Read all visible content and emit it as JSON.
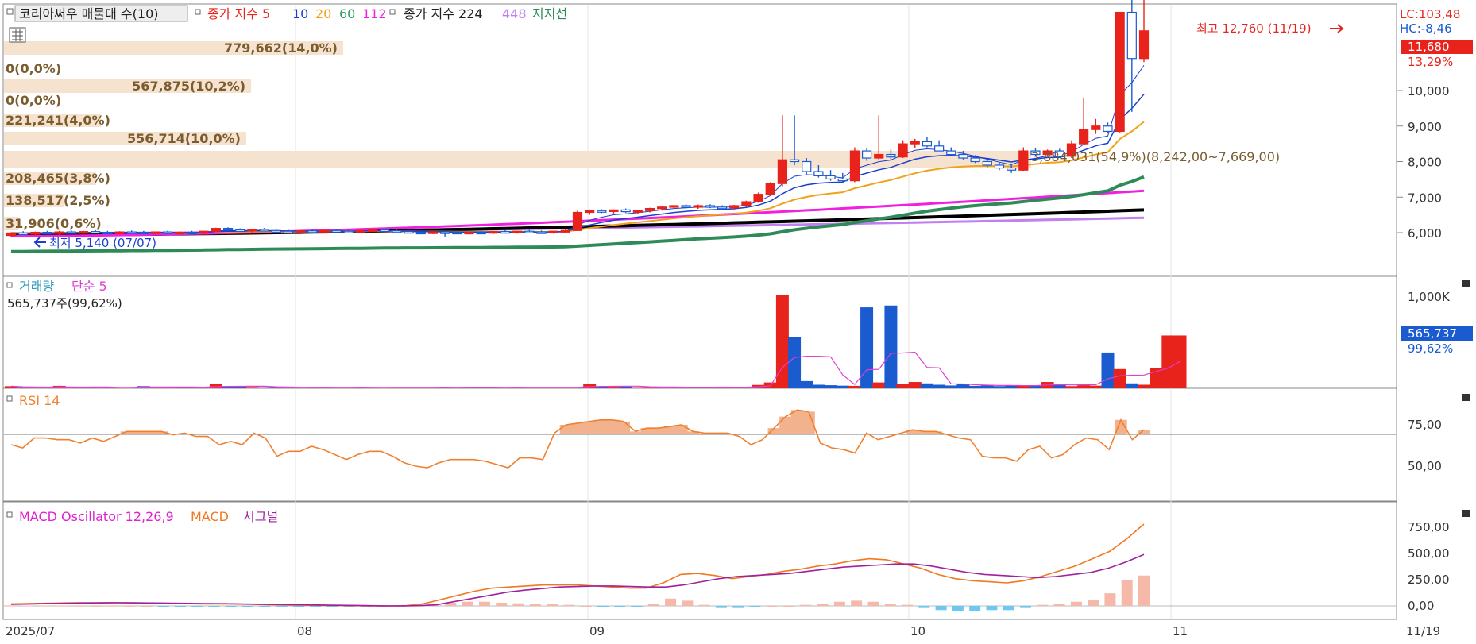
{
  "colors": {
    "up": "#e8231b",
    "down": "#1a5bd0",
    "ma5": "#1a3fd0",
    "ma10": "#1a3fd0",
    "ma20": "#f0a21a",
    "ma60": "#2e9a5e",
    "ma112": "#f020e0",
    "ma224": "#000000",
    "ma448": "#c080f0",
    "support": "#2e8b57",
    "volume_ma": "#e040d0",
    "rsi": "#f08030",
    "rsi_fill": "#f2b28e",
    "macd": "#f07820",
    "signal": "#a020a0",
    "osc_pos": "#f6b8a8",
    "osc_neg": "#6cc8f0",
    "profile": "#f5e3cf"
  },
  "price_panel": {
    "legend": {
      "title": "코리아써우 매물대 수(10)",
      "ma_label": "종가 지수 5",
      "ma_10": "10",
      "ma_20": "20",
      "ma_60": "60",
      "ma_112": "112",
      "ma_long_label": "종가 지수 224",
      "ma_448": "448",
      "support": "지지선"
    },
    "high_label": "최고 12,760 (11/19)",
    "low_label": "최저 5,140 (07/07)",
    "current_label": "3,884,031(54,9%)(8,242,00~7,669,00)",
    "axis_badge_lc": "LC:103,48",
    "axis_badge_hc": "HC:-8,46",
    "current_price": "11,680",
    "current_pct": "13,29%",
    "yaxis_ticks": [
      "10,000",
      "9,000",
      "8,000",
      "7,000",
      "6,000"
    ]
  },
  "volume_profile": [
    {
      "label": "779,662(14,0%)",
      "pct": 14.0
    },
    {
      "label": "0(0,0%)",
      "pct": 0
    },
    {
      "label": "567,875(10,2%)",
      "pct": 10.2
    },
    {
      "label": "0(0,0%)",
      "pct": 0
    },
    {
      "label": "221,241(4,0%)",
      "pct": 4.0
    },
    {
      "label": "556,714(10,0%)",
      "pct": 10.0
    },
    {
      "label": "",
      "pct": 54.9
    },
    {
      "label": "208,465(3,8%)",
      "pct": 3.8
    },
    {
      "label": "138,517(2,5%)",
      "pct": 2.5
    },
    {
      "label": "31,906(0,6%)",
      "pct": 0.6
    }
  ],
  "volume_panel": {
    "legend_vol": "거래량",
    "legend_ma": "단순 5",
    "current_text": "565,737주(99,62%)",
    "axis_tick": "1,000K",
    "current_value": "565,737",
    "current_pct": "99,62%"
  },
  "rsi_panel": {
    "legend": "RSI 14",
    "ticks": [
      "75,00",
      "50,00"
    ]
  },
  "macd_panel": {
    "legend_osc": "MACD Oscillator 12,26,9",
    "legend_macd": "MACD",
    "legend_signal": "시그널",
    "ticks": [
      "750,00",
      "500,00",
      "250,00",
      "0,00"
    ]
  },
  "x_axis": {
    "labels": [
      "2025/07",
      "08",
      "09",
      "10",
      "11",
      "11/19"
    ]
  },
  "chart_data": [
    {
      "type": "candlestick",
      "title": "코리아써우",
      "ylim": [
        5140,
        12760
      ],
      "x_start": "2025-07-01",
      "x_end": "2025-11-19",
      "key_points": [
        {
          "date": "07/07",
          "low": 5140
        },
        {
          "date": "09/08",
          "close": 6600
        },
        {
          "date": "10/02",
          "close": 8050
        },
        {
          "date": "10/14",
          "close": 8000
        },
        {
          "date": "10/23",
          "close": 8300
        },
        {
          "date": "11/13",
          "close": 8400
        },
        {
          "date": "11/17",
          "close": 12200
        },
        {
          "date": "11/19",
          "high": 12760,
          "close": 11680
        }
      ],
      "candles": [
        [
          5920,
          6010,
          5870,
          5990
        ],
        [
          5990,
          6040,
          5950,
          5960
        ],
        [
          5960,
          6030,
          5920,
          6010
        ],
        [
          6010,
          6050,
          5960,
          5980
        ],
        [
          5980,
          6050,
          5940,
          6020
        ],
        [
          6020,
          6060,
          5980,
          6000
        ],
        [
          6000,
          6050,
          5960,
          6030
        ],
        [
          6030,
          6070,
          5990,
          6010
        ],
        [
          6010,
          6050,
          5970,
          6000
        ],
        [
          6000,
          6040,
          5950,
          6020
        ],
        [
          6020,
          6060,
          5980,
          6010
        ],
        [
          6010,
          6050,
          5960,
          5990
        ],
        [
          5990,
          6030,
          5950,
          6020
        ],
        [
          6020,
          6060,
          5980,
          6000
        ],
        [
          6000,
          6040,
          5960,
          6010
        ],
        [
          6010,
          6050,
          5970,
          5990
        ],
        [
          5990,
          6030,
          5940,
          6040
        ],
        [
          6040,
          6140,
          6010,
          6120
        ],
        [
          6120,
          6150,
          6060,
          6080
        ],
        [
          6080,
          6120,
          6030,
          6050
        ],
        [
          6050,
          6110,
          6010,
          6090
        ],
        [
          6090,
          6130,
          6040,
          6060
        ],
        [
          6060,
          6100,
          6010,
          6040
        ],
        [
          6040,
          6080,
          5990,
          6020
        ],
        [
          6020,
          6070,
          5980,
          6050
        ],
        [
          6050,
          6090,
          6000,
          6030
        ],
        [
          6030,
          6070,
          5980,
          6060
        ],
        [
          6060,
          6100,
          6010,
          6040
        ],
        [
          6040,
          6080,
          5990,
          6020
        ],
        [
          6020,
          6070,
          5980,
          6060
        ],
        [
          6060,
          6100,
          6020,
          6080
        ],
        [
          6080,
          6110,
          6030,
          6050
        ],
        [
          6050,
          6090,
          6000,
          6030
        ],
        [
          6030,
          6070,
          5980,
          6010
        ],
        [
          6010,
          6060,
          5970,
          6000
        ],
        [
          6000,
          6040,
          5960,
          6020
        ],
        [
          6020,
          6060,
          5890,
          6010
        ],
        [
          6010,
          6040,
          5960,
          5990
        ],
        [
          5990,
          6030,
          5950,
          6010
        ],
        [
          6010,
          6050,
          5970,
          6000
        ],
        [
          6000,
          6040,
          5960,
          6030
        ],
        [
          6030,
          6070,
          5990,
          6010
        ],
        [
          6010,
          6050,
          5970,
          6040
        ],
        [
          6040,
          6080,
          6000,
          6020
        ],
        [
          6020,
          6060,
          5980,
          6010
        ],
        [
          6010,
          6050,
          5970,
          6040
        ],
        [
          6040,
          6090,
          6000,
          6060
        ],
        [
          6060,
          6620,
          6050,
          6570
        ],
        [
          6570,
          6650,
          6500,
          6620
        ],
        [
          6620,
          6660,
          6550,
          6600
        ],
        [
          6600,
          6650,
          6540,
          6640
        ],
        [
          6640,
          6680,
          6560,
          6590
        ],
        [
          6590,
          6640,
          6530,
          6620
        ],
        [
          6620,
          6700,
          6570,
          6680
        ],
        [
          6680,
          6740,
          6620,
          6720
        ],
        [
          6720,
          6780,
          6660,
          6760
        ],
        [
          6760,
          6800,
          6690,
          6730
        ],
        [
          6730,
          6790,
          6670,
          6760
        ],
        [
          6760,
          6800,
          6690,
          6720
        ],
        [
          6720,
          6770,
          6660,
          6700
        ],
        [
          6700,
          6780,
          6640,
          6760
        ],
        [
          6760,
          6900,
          6720,
          6870
        ],
        [
          6870,
          7130,
          6840,
          7080
        ],
        [
          7080,
          7420,
          7040,
          7380
        ],
        [
          7380,
          9300,
          7300,
          8050
        ],
        [
          8050,
          9300,
          7900,
          8000
        ],
        [
          8000,
          8100,
          7650,
          7720
        ],
        [
          7720,
          7900,
          7550,
          7600
        ],
        [
          7600,
          7760,
          7460,
          7510
        ],
        [
          7510,
          7680,
          7420,
          7460
        ],
        [
          7460,
          8400,
          7420,
          8300
        ],
        [
          8300,
          8380,
          8020,
          8100
        ],
        [
          8100,
          9300,
          8050,
          8200
        ],
        [
          8200,
          8340,
          8060,
          8130
        ],
        [
          8130,
          8600,
          8100,
          8500
        ],
        [
          8500,
          8640,
          8380,
          8560
        ],
        [
          8560,
          8700,
          8400,
          8440
        ],
        [
          8440,
          8600,
          8330,
          8300
        ],
        [
          8300,
          8400,
          8160,
          8200
        ],
        [
          8200,
          8300,
          8060,
          8100
        ],
        [
          8100,
          8180,
          7960,
          8000
        ],
        [
          8000,
          8080,
          7840,
          7900
        ],
        [
          7900,
          7980,
          7760,
          7820
        ],
        [
          7820,
          7900,
          7680,
          7760
        ],
        [
          7760,
          8400,
          7740,
          8300
        ],
        [
          8300,
          8380,
          8150,
          8200
        ],
        [
          8200,
          8340,
          8150,
          8300
        ],
        [
          8300,
          8360,
          8100,
          8150
        ],
        [
          8150,
          8600,
          8100,
          8500
        ],
        [
          8500,
          9800,
          8460,
          8900
        ],
        [
          8900,
          9200,
          8780,
          9000
        ],
        [
          9000,
          9100,
          8800,
          8850
        ],
        [
          8850,
          12200,
          8820,
          12200
        ],
        [
          12200,
          12760,
          9400,
          10900
        ],
        [
          10900,
          12760,
          10800,
          11680
        ]
      ]
    },
    {
      "type": "bar",
      "title": "거래량",
      "series": [
        {
          "name": "단순 5",
          "values": [
            14,
            2,
            1,
            1,
            18,
            2,
            1,
            2,
            4,
            1,
            2,
            15,
            3,
            4,
            5,
            3,
            2,
            35,
            14,
            12,
            6,
            2,
            4,
            1,
            2,
            6,
            3,
            1,
            2,
            4,
            1,
            2,
            3,
            1,
            4,
            2,
            6,
            1,
            5,
            4,
            2,
            1,
            4,
            2,
            3,
            1,
            4,
            2,
            40,
            12,
            8,
            11,
            4,
            3,
            2,
            6,
            4,
            2,
            5,
            3,
            2,
            6,
            28,
            55,
            1000,
            545,
            70,
            30,
            25,
            20,
            18,
            870,
            55,
            890,
            42,
            60,
            45,
            30,
            22,
            35,
            18,
            24,
            15,
            25,
            20,
            18,
            60,
            30,
            15,
            25,
            20,
            380,
            200,
            45,
            30,
            210,
            565,
            565
          ]
        }
      ]
    },
    {
      "type": "line",
      "title": "RSI 14",
      "ylim": [
        30,
        95
      ],
      "series": [
        {
          "name": "RSI 14",
          "values": [
            63,
            61,
            67,
            67,
            66,
            66,
            64,
            67,
            65,
            68,
            71,
            71,
            71,
            71,
            69,
            70,
            68,
            68,
            63,
            65,
            63,
            70,
            67,
            56,
            59,
            59,
            62,
            60,
            57,
            54,
            57,
            59,
            59,
            56,
            52,
            50,
            49,
            52,
            54,
            54,
            54,
            53,
            51,
            49,
            55,
            55,
            54,
            70,
            75,
            76,
            77,
            78,
            78,
            77,
            71,
            73,
            73,
            74,
            75,
            71,
            70,
            70,
            70,
            68,
            63,
            66,
            73,
            80,
            84,
            83,
            64,
            61,
            60,
            58,
            70,
            66,
            68,
            70,
            72,
            71,
            71,
            69,
            67,
            66,
            56,
            55,
            55,
            53,
            60,
            62,
            55,
            57,
            63,
            67,
            66,
            60,
            78,
            66,
            72
          ]
        }
      ]
    },
    {
      "type": "line",
      "title": "MACD Oscillator 12,26,9",
      "ylim": [
        -60,
        850
      ],
      "series": [
        {
          "name": "MACD",
          "values": [
            20,
            22,
            25,
            28,
            30,
            30,
            32,
            30,
            28,
            25,
            22,
            20,
            20,
            18,
            15,
            12,
            10,
            8,
            5,
            4,
            2,
            0,
            0,
            2,
            20,
            60,
            100,
            140,
            170,
            180,
            190,
            200,
            200,
            200,
            190,
            180,
            170,
            170,
            220,
            300,
            310,
            290,
            260,
            280,
            300,
            330,
            350,
            380,
            400,
            430,
            450,
            440,
            400,
            360,
            300,
            260,
            240,
            230,
            220,
            240,
            280,
            330,
            380,
            450,
            520,
            640,
            780
          ]
        },
        {
          "name": "시그널",
          "values": [
            15,
            18,
            22,
            25,
            28,
            29,
            30,
            29,
            28,
            26,
            24,
            22,
            21,
            19,
            17,
            14,
            12,
            10,
            7,
            5,
            3,
            1,
            0,
            2,
            10,
            40,
            70,
            100,
            130,
            150,
            165,
            180,
            185,
            190,
            190,
            185,
            180,
            180,
            200,
            230,
            260,
            280,
            290,
            300,
            310,
            330,
            350,
            370,
            380,
            390,
            400,
            400,
            380,
            350,
            320,
            300,
            290,
            280,
            270,
            280,
            300,
            320,
            360,
            420,
            490
          ]
        }
      ],
      "oscillator": [
        5,
        4,
        3,
        3,
        2,
        1,
        2,
        1,
        0,
        -1,
        -2,
        -2,
        -1,
        -1,
        -2,
        -2,
        -2,
        -2,
        -2,
        -1,
        -1,
        -1,
        0,
        0,
        10,
        20,
        30,
        40,
        40,
        30,
        25,
        20,
        15,
        10,
        0,
        -5,
        -10,
        -10,
        20,
        70,
        50,
        10,
        -20,
        -20,
        -10,
        0,
        0,
        10,
        20,
        40,
        50,
        40,
        20,
        10,
        -20,
        -40,
        -50,
        -50,
        -40,
        -40,
        -20,
        10,
        20,
        40,
        60,
        120,
        250,
        290
      ]
    }
  ]
}
